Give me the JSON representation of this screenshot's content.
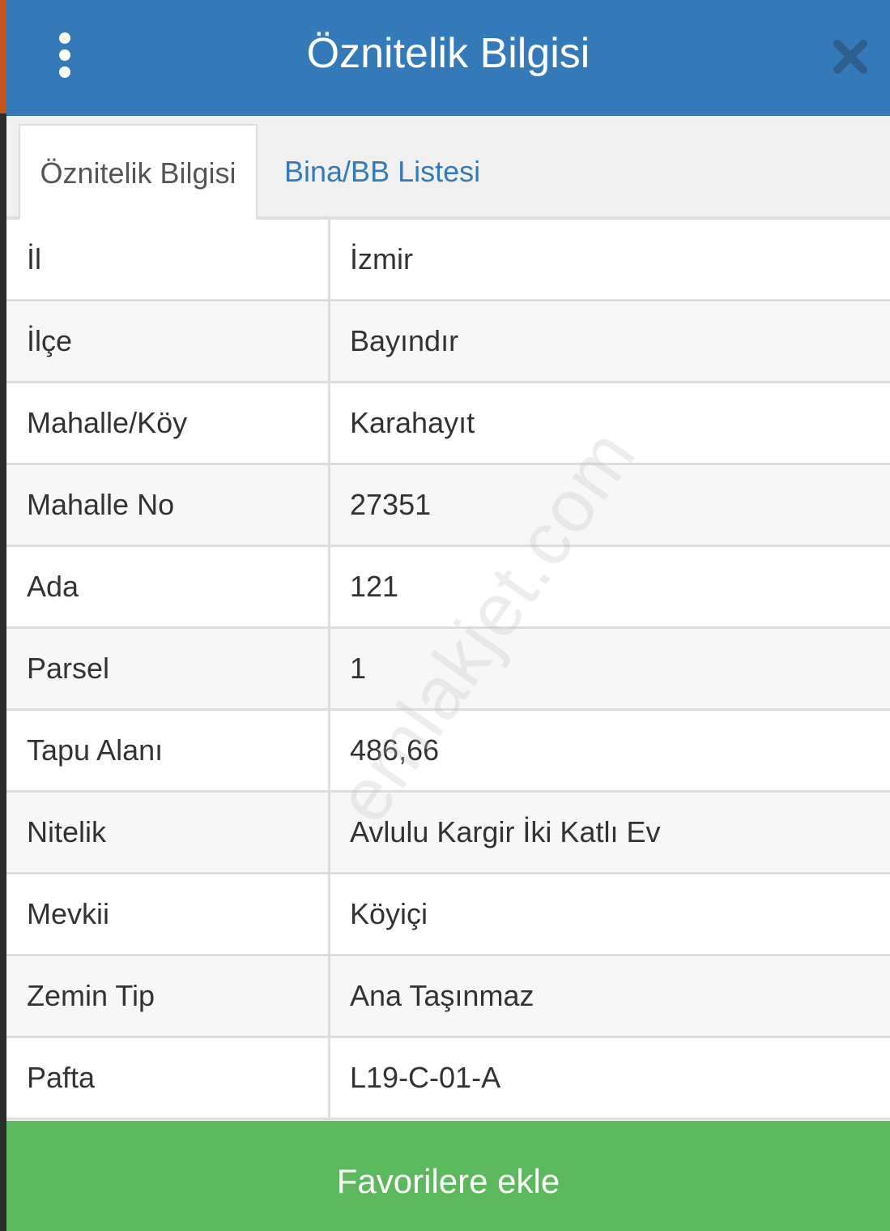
{
  "header": {
    "title": "Öznitelik Bilgisi",
    "menu_icon": "vertical-dots-icon",
    "close_icon": "close-icon"
  },
  "tabs": [
    {
      "label": "Öznitelik Bilgisi",
      "active": true
    },
    {
      "label": "Bina/BB Listesi",
      "active": false
    }
  ],
  "rows": [
    {
      "label": "İl",
      "value": "İzmir"
    },
    {
      "label": "İlçe",
      "value": "Bayındır"
    },
    {
      "label": "Mahalle/Köy",
      "value": "Karahayıt"
    },
    {
      "label": "Mahalle No",
      "value": "27351"
    },
    {
      "label": "Ada",
      "value": "121"
    },
    {
      "label": "Parsel",
      "value": "1"
    },
    {
      "label": "Tapu Alanı",
      "value": "486,66"
    },
    {
      "label": "Nitelik",
      "value": "Avlulu Kargir İki Katlı Ev"
    },
    {
      "label": "Mevkii",
      "value": "Köyiçi"
    },
    {
      "label": "Zemin Tip",
      "value": "Ana Taşınmaz"
    },
    {
      "label": "Pafta",
      "value": "L19-C-01-A"
    }
  ],
  "watermark": "emlakjet.com",
  "footer": {
    "favorite_label": "Favorilere ekle"
  },
  "colors": {
    "header_bg": "#357ab8",
    "button_bg": "#5cb85c",
    "tab_link": "#357ab8"
  }
}
